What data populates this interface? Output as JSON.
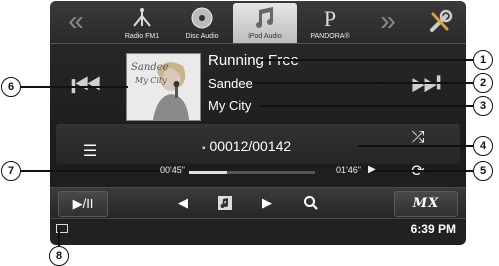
{
  "source_tabs": [
    {
      "label": "Radio FM1",
      "icon": "antenna-icon"
    },
    {
      "label": "Disc Audio",
      "icon": "disc-icon"
    },
    {
      "label": "iPod Audio",
      "icon": "music-note-icon"
    },
    {
      "label": "PANDORA®",
      "icon": "pandora-logo-icon"
    }
  ],
  "active_source": "iPod Audio",
  "nav": {
    "prev_arrows": "«",
    "next_arrows": "»"
  },
  "track": {
    "title": "Running Free",
    "artist": "Sandee",
    "album": "My City",
    "track_counter": "00012/00142",
    "elapsed": "00'45\"",
    "remaining": "01'46\"",
    "progress": 0.3
  },
  "album_art": {
    "script_text_1": "Sandee",
    "script_text_2": "My City"
  },
  "bottom": {
    "play_pause": "▶/II",
    "logo": "MX"
  },
  "status": {
    "time": "6:39 PM"
  },
  "callouts": [
    "1",
    "2",
    "3",
    "4",
    "5",
    "6",
    "7",
    "8"
  ],
  "colors": {
    "screen_bg": "#1e1e1e",
    "active_tab": "#d6d6d6",
    "text": "#ffffff"
  }
}
